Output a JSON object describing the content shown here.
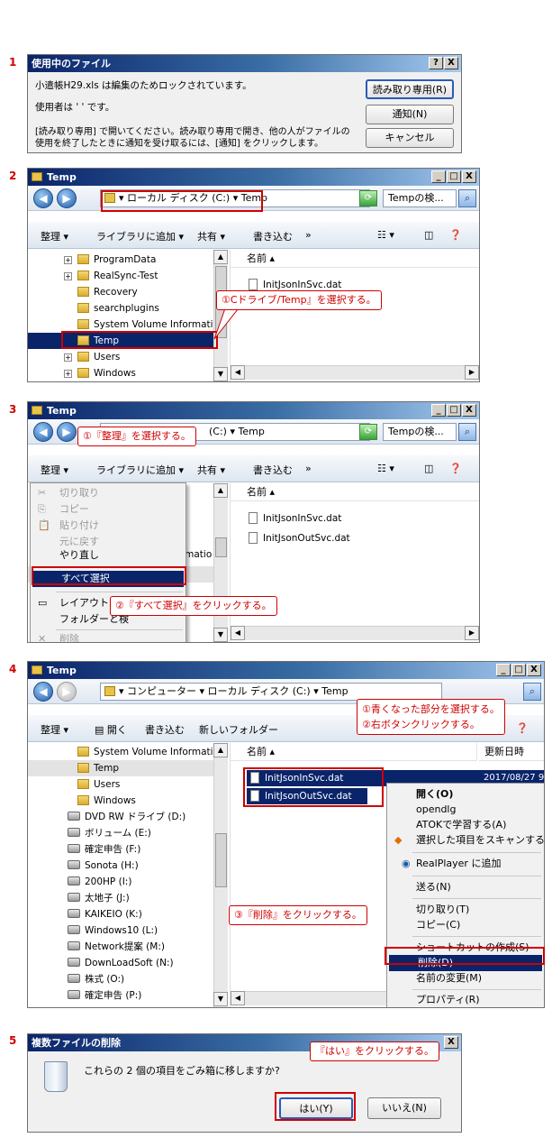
{
  "steps": [
    "1",
    "2",
    "3",
    "4",
    "5"
  ],
  "dialog1": {
    "title": "使用中のファイル",
    "msg1": "小遣帳H29.xls は編集のためロックされています。",
    "msg2": "使用者は ' ' です。",
    "msg3": "[読み取り専用] で開いてください。読み取り専用で開き、他の人がファイルの",
    "msg4": "使用を終了したときに通知を受け取るには、[通知] をクリックします。",
    "btn_readonly": "読み取り専用(R)",
    "btn_notify": "通知(N)",
    "btn_cancel": "キャンセル",
    "help": "?",
    "close": "X"
  },
  "explorer": {
    "title": "Temp",
    "path2": "▾ ローカル ディスク (C:) ▾ Temp",
    "path3": "(C:) ▾ Temp",
    "path4": "▾ コンピューター ▾ ローカル ディスク (C:) ▾ Temp",
    "search": "Tempの検...",
    "organize": "整理",
    "library": "ライブラリに追加",
    "share": "共有",
    "burn": "書き込む",
    "more": "»",
    "open": "開く",
    "newfolder": "新しいフォルダー",
    "col_name": "名前",
    "col_date": "更新日時",
    "min": "_",
    "max": "□",
    "close": "X"
  },
  "tree2": [
    "ProgramData",
    "RealSync-Test",
    "Recovery",
    "searchplugins",
    "System Volume Informatio",
    "Temp",
    "Users",
    "Windows"
  ],
  "files": [
    "InitJsonInSvc.dat",
    "InitJsonOutSvc.dat"
  ],
  "file_date": "2017/08/27 9",
  "callout2": "①Cドライブ/Temp』を選択する。",
  "menu3": {
    "items": [
      "切り取り",
      "コピー",
      "貼り付け",
      "元に戻す",
      "やり直し",
      "すべて選択",
      "レイアウト",
      "フォルダーと検",
      "削除"
    ],
    "tree_tail": "rmatio",
    "callout1": "①『整理』を選択する。",
    "callout2": "②『すべて選択』をクリックする。"
  },
  "tree4": [
    "System Volume Informatio",
    "Temp",
    "Users",
    "Windows",
    "DVD RW ドライブ (D:)",
    "ボリューム (E:)",
    "確定申告 (F:)",
    "Sonota (H:)",
    "200HP (I:)",
    "太地子 (J:)",
    "KAIKEIO (K:)",
    "Windows10 (L:)",
    "Network提案 (M:)",
    "DownLoadSoft (N:)",
    "株式 (O:)",
    "確定申告 (P:)"
  ],
  "ctx4": [
    "開く(O)",
    "opendlg",
    "ATOKで学習する(A)",
    "選択した項目をスキャンする (S)",
    "RealPlayer に追加",
    "送る(N)",
    "切り取り(T)",
    "コピー(C)",
    "ショートカットの作成(S)",
    "削除(D)",
    "名前の変更(M)",
    "プロパティ(R)"
  ],
  "callout4a": "①青くなった部分を選択する。",
  "callout4b": "②右ボタンクリックする。",
  "callout4c": "③『削除』をクリックする。",
  "dialog5": {
    "title": "複数ファイルの削除",
    "msg": "これらの 2 個の項目をごみ箱に移しますか?",
    "yes": "はい(Y)",
    "no": "いいえ(N)",
    "close": "X",
    "callout": "『はい』をクリックする。"
  },
  "colors": {
    "accent_red": "#d00000",
    "title_blue": "#0a246a",
    "select_blue": "#0a246a"
  }
}
